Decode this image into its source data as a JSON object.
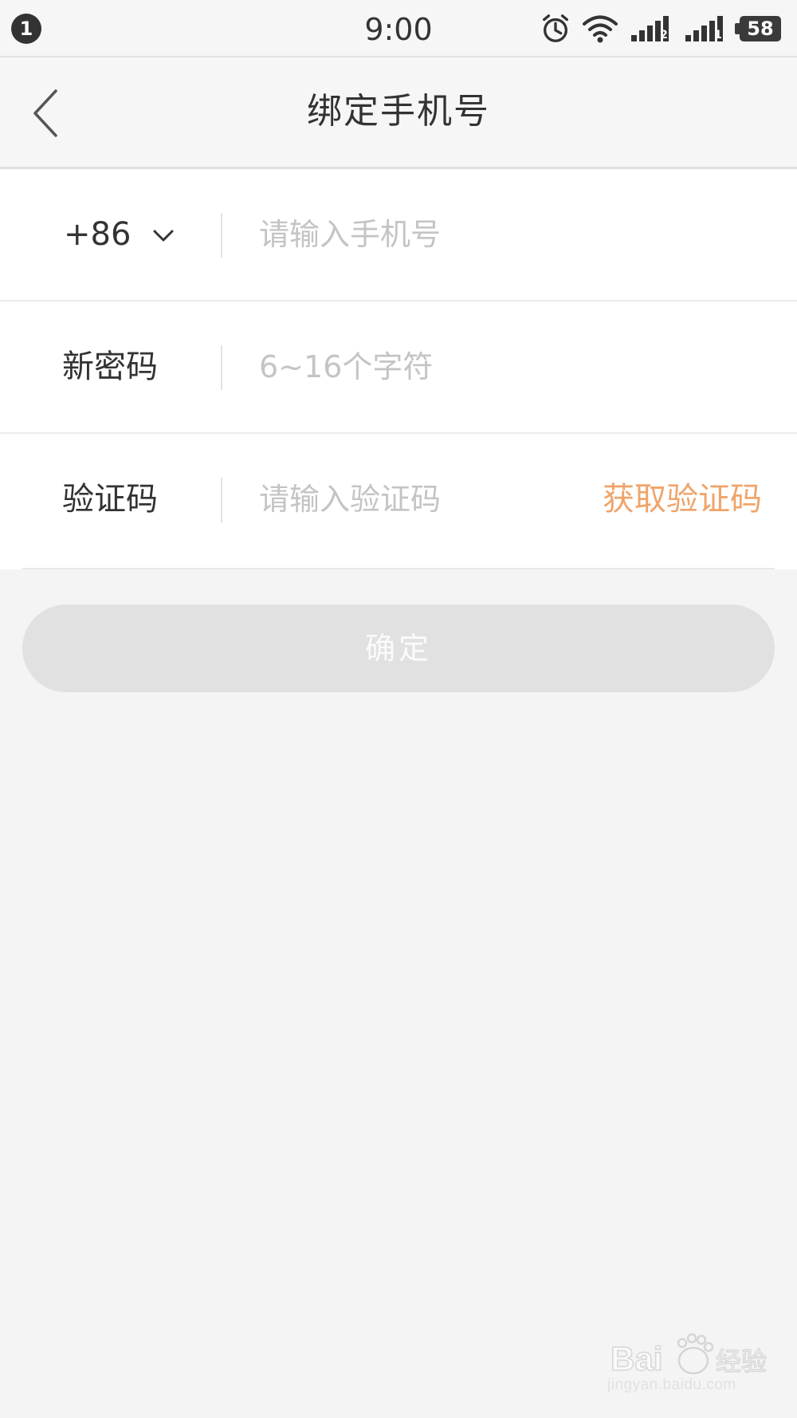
{
  "status_bar": {
    "notification_count": "1",
    "time": "9:00",
    "sim1_label": "2",
    "sim2_label": "1",
    "battery_level": "58",
    "icons": [
      "alarm-icon",
      "wifi-icon",
      "signal-icon",
      "signal-icon",
      "battery-icon"
    ]
  },
  "header": {
    "title": "绑定手机号",
    "back_icon": "chevron-left-icon"
  },
  "form": {
    "phone": {
      "country_code": "+86",
      "placeholder": "请输入手机号",
      "value": ""
    },
    "password": {
      "label": "新密码",
      "placeholder": "6~16个字符",
      "value": ""
    },
    "code": {
      "label": "验证码",
      "placeholder": "请输入验证码",
      "value": "",
      "get_code_label": "获取验证码"
    }
  },
  "confirm_label": "确定",
  "colors": {
    "accent": "#f0a46a",
    "button_disabled": "#e1e1e1",
    "background": "#f4f4f4"
  },
  "watermark": {
    "brand": "Baidu经验",
    "url": "jingyan.baidu.com"
  }
}
